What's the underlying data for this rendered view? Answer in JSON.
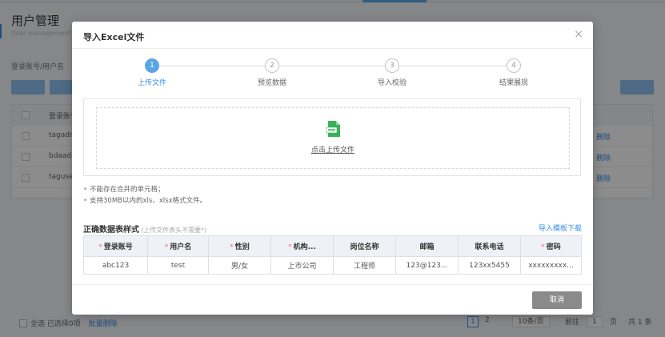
{
  "background": {
    "page_title": "用户管理",
    "page_subtitle": "User management info",
    "search_label": "登录账号/用户名",
    "table_header_first": "登录账号",
    "rows": [
      "tagadm",
      "bdaadm",
      "taguse"
    ],
    "row_action": "删除",
    "footer": {
      "select_all": "全选 已选择0项",
      "batch_delete": "批量删除"
    },
    "pager": {
      "current": "1",
      "next": "2",
      "page_size": "10条/页",
      "goto_label": "前往",
      "goto_value": "1",
      "page_unit": "页",
      "total": "共 1 条"
    }
  },
  "modal": {
    "title": "导入Excel文件",
    "close_symbol": "×",
    "steps": [
      {
        "index": "1",
        "label": "上传文件",
        "active": true
      },
      {
        "index": "2",
        "label": "预览数据",
        "active": false
      },
      {
        "index": "3",
        "label": "导入校验",
        "active": false
      },
      {
        "index": "4",
        "label": "结果展现",
        "active": false
      }
    ],
    "upload": {
      "text": "点击上传文件",
      "icon": "excel-file-icon",
      "icon_color": "#3bb15c"
    },
    "tips": [
      "不能存在合并的单元格；",
      "支持30MB以内的xls、xlsx格式文件。"
    ],
    "sample": {
      "title": "正确数据表样式",
      "hint": "(上传文件表头不需要*)",
      "download": "导入模板下载",
      "headers": [
        {
          "label": "登录账号",
          "required": true
        },
        {
          "label": "用户名",
          "required": true
        },
        {
          "label": "性别",
          "required": true
        },
        {
          "label": "机构...",
          "required": true
        },
        {
          "label": "岗位名称",
          "required": false
        },
        {
          "label": "邮箱",
          "required": false
        },
        {
          "label": "联系电话",
          "required": false
        },
        {
          "label": "密码",
          "required": true
        }
      ],
      "row": [
        "abc123",
        "test",
        "男/女",
        "上市公司",
        "工程师",
        "123@123...",
        "123xx5455",
        "xxxxxxxxx..."
      ]
    },
    "cancel": "取消"
  },
  "colors": {
    "accent": "#3a8ee6",
    "step_active": "#5aa5e6",
    "required": "#f56c6c",
    "cancel_bg": "#8a8a8a"
  }
}
